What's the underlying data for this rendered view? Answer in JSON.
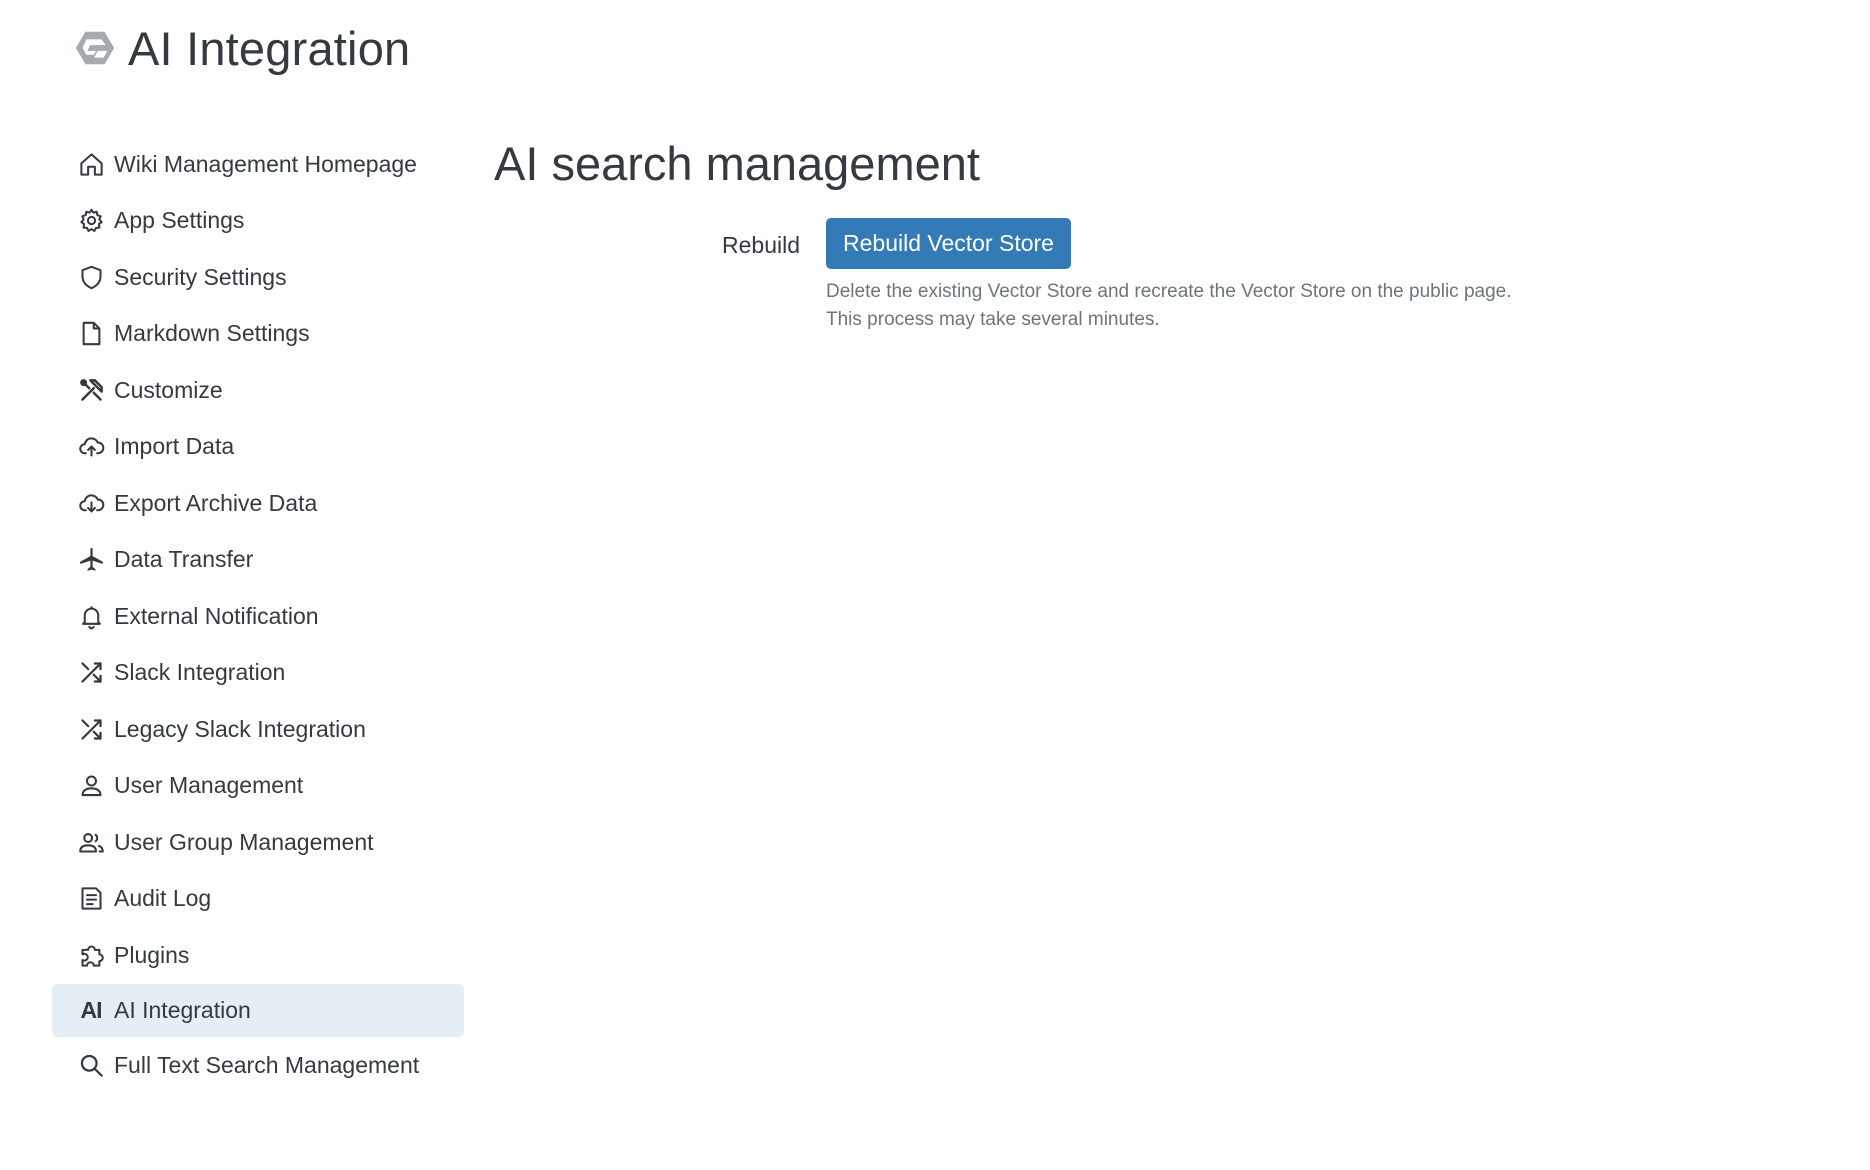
{
  "app": {
    "title": "AI Integration"
  },
  "sidebar": {
    "items": [
      {
        "label": "Wiki Management Homepage",
        "icon": "home-icon"
      },
      {
        "label": "App Settings",
        "icon": "gear-icon"
      },
      {
        "label": "Security Settings",
        "icon": "shield-icon"
      },
      {
        "label": "Markdown Settings",
        "icon": "file-icon"
      },
      {
        "label": "Customize",
        "icon": "tools-icon"
      },
      {
        "label": "Import Data",
        "icon": "cloud-upload-icon"
      },
      {
        "label": "Export Archive Data",
        "icon": "cloud-download-icon"
      },
      {
        "label": "Data Transfer",
        "icon": "airplane-icon"
      },
      {
        "label": "External Notification",
        "icon": "bell-icon"
      },
      {
        "label": "Slack Integration",
        "icon": "shuffle-icon"
      },
      {
        "label": "Legacy Slack Integration",
        "icon": "shuffle-icon"
      },
      {
        "label": "User Management",
        "icon": "user-icon"
      },
      {
        "label": "User Group Management",
        "icon": "users-icon"
      },
      {
        "label": "Audit Log",
        "icon": "document-icon"
      },
      {
        "label": "Plugins",
        "icon": "puzzle-icon"
      },
      {
        "label": "AI Integration",
        "icon": "ai-icon",
        "active": true
      },
      {
        "label": "Full Text Search Management",
        "icon": "search-icon"
      }
    ]
  },
  "main": {
    "title": "AI search management",
    "rebuild": {
      "label": "Rebuild",
      "button_label": "Rebuild Vector Store",
      "help_line1": "Delete the existing Vector Store and recreate the Vector Store on the public page.",
      "help_line2": "This process may take several minutes."
    }
  },
  "colors": {
    "accent": "#337ab7",
    "active_bg": "#e5eef4",
    "text": "#343a40",
    "muted": "#6c757d"
  }
}
